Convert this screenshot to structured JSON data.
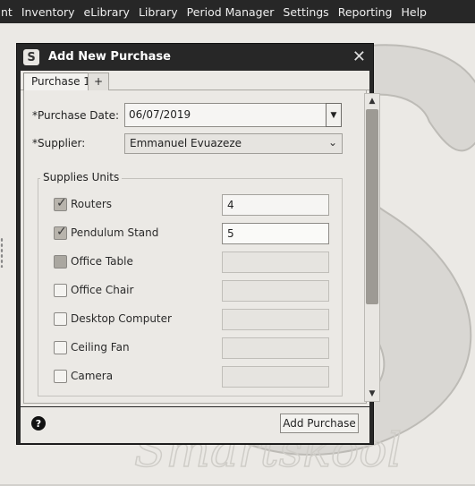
{
  "menubar": {
    "items": [
      "nt",
      "Inventory",
      "eLibrary",
      "Library",
      "Period Manager",
      "Settings",
      "Reporting",
      "Help"
    ]
  },
  "background": {
    "watermark_text": "Smartskool"
  },
  "dialog": {
    "title": "Add New Purchase",
    "close_icon": "close-icon",
    "tabs": [
      {
        "label": "Purchase 1",
        "active": true
      },
      {
        "label": "+",
        "active": false
      }
    ],
    "purchase_date": {
      "label": "*Purchase Date:",
      "value": "06/07/2019"
    },
    "supplier": {
      "label": "*Supplier:",
      "value": "Emmanuel Evuazeze"
    },
    "supplies": {
      "group_title": "Supplies Units",
      "rows": [
        {
          "name": "Routers",
          "checked": true,
          "qty": "4"
        },
        {
          "name": "Pendulum Stand",
          "checked": true,
          "qty": "5"
        },
        {
          "name": "Office Table",
          "checked": false,
          "qty": ""
        },
        {
          "name": "Office Chair",
          "checked": false,
          "qty": ""
        },
        {
          "name": "Desktop Computer",
          "checked": false,
          "qty": ""
        },
        {
          "name": "Ceiling Fan",
          "checked": false,
          "qty": ""
        },
        {
          "name": "Camera",
          "checked": false,
          "qty": ""
        }
      ]
    },
    "footer": {
      "help_icon": "?",
      "add_button": "Add Purchase"
    }
  },
  "colors": {
    "menubar_bg": "#272727",
    "dialog_frame": "#272727",
    "panel_bg": "#ebe9e5"
  }
}
